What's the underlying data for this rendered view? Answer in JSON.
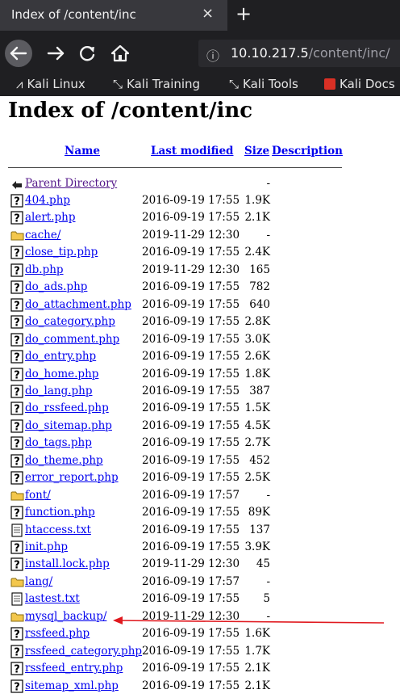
{
  "browser": {
    "tab_title": "Index of /content/inc",
    "tab_close": "×",
    "new_tab": "+",
    "url_host": "10.10.217.5",
    "url_path": "/content/inc/",
    "info_icon": "ⓘ",
    "bookmarks": [
      {
        "label": "Kali Linux",
        "icon": "kali-dragon-icon"
      },
      {
        "label": "Kali Training",
        "icon": "kali-dragon-icon"
      },
      {
        "label": "Kali Tools",
        "icon": "kali-dragon-icon"
      },
      {
        "label": "Kali Docs",
        "icon": "kali-docs-icon"
      }
    ]
  },
  "page": {
    "heading": "Index of /content/inc",
    "columns": {
      "name": "Name",
      "last_modified": "Last modified",
      "size": "Size",
      "description": "Description"
    },
    "parent": {
      "name": "Parent Directory",
      "size": "-"
    },
    "entries": [
      {
        "name": "404.php",
        "date": "2016-09-19 17:55",
        "size": "1.9K",
        "type": "file"
      },
      {
        "name": "alert.php",
        "date": "2016-09-19 17:55",
        "size": "2.1K",
        "type": "file"
      },
      {
        "name": "cache/",
        "date": "2019-11-29 12:30",
        "size": "-",
        "type": "folder"
      },
      {
        "name": "close_tip.php",
        "date": "2016-09-19 17:55",
        "size": "2.4K",
        "type": "file"
      },
      {
        "name": "db.php",
        "date": "2019-11-29 12:30",
        "size": "165",
        "type": "file"
      },
      {
        "name": "do_ads.php",
        "date": "2016-09-19 17:55",
        "size": "782",
        "type": "file"
      },
      {
        "name": "do_attachment.php",
        "date": "2016-09-19 17:55",
        "size": "640",
        "type": "file"
      },
      {
        "name": "do_category.php",
        "date": "2016-09-19 17:55",
        "size": "2.8K",
        "type": "file"
      },
      {
        "name": "do_comment.php",
        "date": "2016-09-19 17:55",
        "size": "3.0K",
        "type": "file"
      },
      {
        "name": "do_entry.php",
        "date": "2016-09-19 17:55",
        "size": "2.6K",
        "type": "file"
      },
      {
        "name": "do_home.php",
        "date": "2016-09-19 17:55",
        "size": "1.8K",
        "type": "file"
      },
      {
        "name": "do_lang.php",
        "date": "2016-09-19 17:55",
        "size": "387",
        "type": "file"
      },
      {
        "name": "do_rssfeed.php",
        "date": "2016-09-19 17:55",
        "size": "1.5K",
        "type": "file"
      },
      {
        "name": "do_sitemap.php",
        "date": "2016-09-19 17:55",
        "size": "4.5K",
        "type": "file"
      },
      {
        "name": "do_tags.php",
        "date": "2016-09-19 17:55",
        "size": "2.7K",
        "type": "file"
      },
      {
        "name": "do_theme.php",
        "date": "2016-09-19 17:55",
        "size": "452",
        "type": "file"
      },
      {
        "name": "error_report.php",
        "date": "2016-09-19 17:55",
        "size": "2.5K",
        "type": "file"
      },
      {
        "name": "font/",
        "date": "2016-09-19 17:57",
        "size": "-",
        "type": "folder"
      },
      {
        "name": "function.php",
        "date": "2016-09-19 17:55",
        "size": "89K",
        "type": "file"
      },
      {
        "name": "htaccess.txt",
        "date": "2016-09-19 17:55",
        "size": "137",
        "type": "text"
      },
      {
        "name": "init.php",
        "date": "2016-09-19 17:55",
        "size": "3.9K",
        "type": "file"
      },
      {
        "name": "install.lock.php",
        "date": "2019-11-29 12:30",
        "size": "45",
        "type": "file"
      },
      {
        "name": "lang/",
        "date": "2016-09-19 17:57",
        "size": "-",
        "type": "folder"
      },
      {
        "name": "lastest.txt",
        "date": "2016-09-19 17:55",
        "size": "5",
        "type": "text"
      },
      {
        "name": "mysql_backup/",
        "date": "2019-11-29 12:30",
        "size": "-",
        "type": "folder"
      },
      {
        "name": "rssfeed.php",
        "date": "2016-09-19 17:55",
        "size": "1.6K",
        "type": "file"
      },
      {
        "name": "rssfeed_category.php",
        "date": "2016-09-19 17:55",
        "size": "1.7K",
        "type": "file"
      },
      {
        "name": "rssfeed_entry.php",
        "date": "2016-09-19 17:55",
        "size": "2.1K",
        "type": "file"
      },
      {
        "name": "sitemap_xml.php",
        "date": "2016-09-19 17:55",
        "size": "2.1K",
        "type": "file"
      }
    ],
    "annotation_color": "#e0191f"
  }
}
